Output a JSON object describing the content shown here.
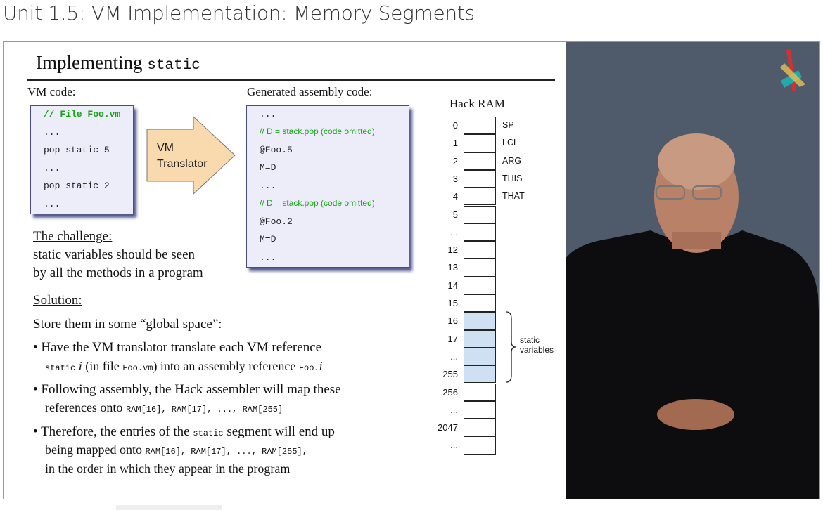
{
  "page_title": "Unit 1.5: VM Implementation: Memory Segments",
  "slide": {
    "title_text": "Implementing",
    "title_code": "static",
    "vm_code_label": "VM code:",
    "vm_code": [
      "// File Foo.vm",
      "...",
      "pop static 5",
      "...",
      "pop static 2",
      "..."
    ],
    "translator_label": [
      "VM",
      "Translator"
    ],
    "asm_label": "Generated assembly code:",
    "asm_code": [
      "...",
      "// D = stack.pop (code omitted)",
      "@Foo.5",
      "M=D",
      "...",
      "// D = stack.pop (code omitted)",
      "@Foo.2",
      "M=D",
      "..."
    ],
    "challenge_heading": "The challenge:",
    "challenge_lines": [
      "static variables should be seen",
      "by all the methods in a program"
    ],
    "solution_heading": "Solution:",
    "solution_intro": "Store them in some “global space”:",
    "bullets": [
      {
        "l1": "Have the VM translator translate each VM reference",
        "l2a": "static",
        "l2b": " i",
        "l2c": " (in file ",
        "l2d": "Foo.vm",
        "l2e": ") into an assembly reference ",
        "l2f": "Foo.",
        "l2g": "i"
      },
      {
        "l1": "Following  assembly, the Hack assembler will map these",
        "l2a": "references onto ",
        "l2b": "RAM[16], RAM[17], ..., RAM[255]"
      },
      {
        "l1a": "Therefore, the entries of the ",
        "l1b": "static",
        "l1c": " segment will end up",
        "l2a": "being mapped onto ",
        "l2b": "RAM[16], RAM[17], ..., RAM[255],",
        "l3": "in the order in which they appear in the program"
      }
    ],
    "ram": {
      "title": "Hack RAM",
      "indices": [
        "0",
        "1",
        "2",
        "3",
        "4",
        "5",
        "...",
        "12",
        "13",
        "14",
        "15",
        "16",
        "17",
        "...",
        "255",
        "256",
        "...",
        "2047",
        "..."
      ],
      "names": [
        "SP",
        "LCL",
        "ARG",
        "THIS",
        "THAT"
      ],
      "static_label": [
        "static",
        "variables"
      ]
    }
  },
  "colors": {
    "comment_green": "#1aa31a",
    "static_fill": "#cfe0f2",
    "arrow_fill": "#f9d9ae",
    "video_bg": "#4f5a6b"
  }
}
